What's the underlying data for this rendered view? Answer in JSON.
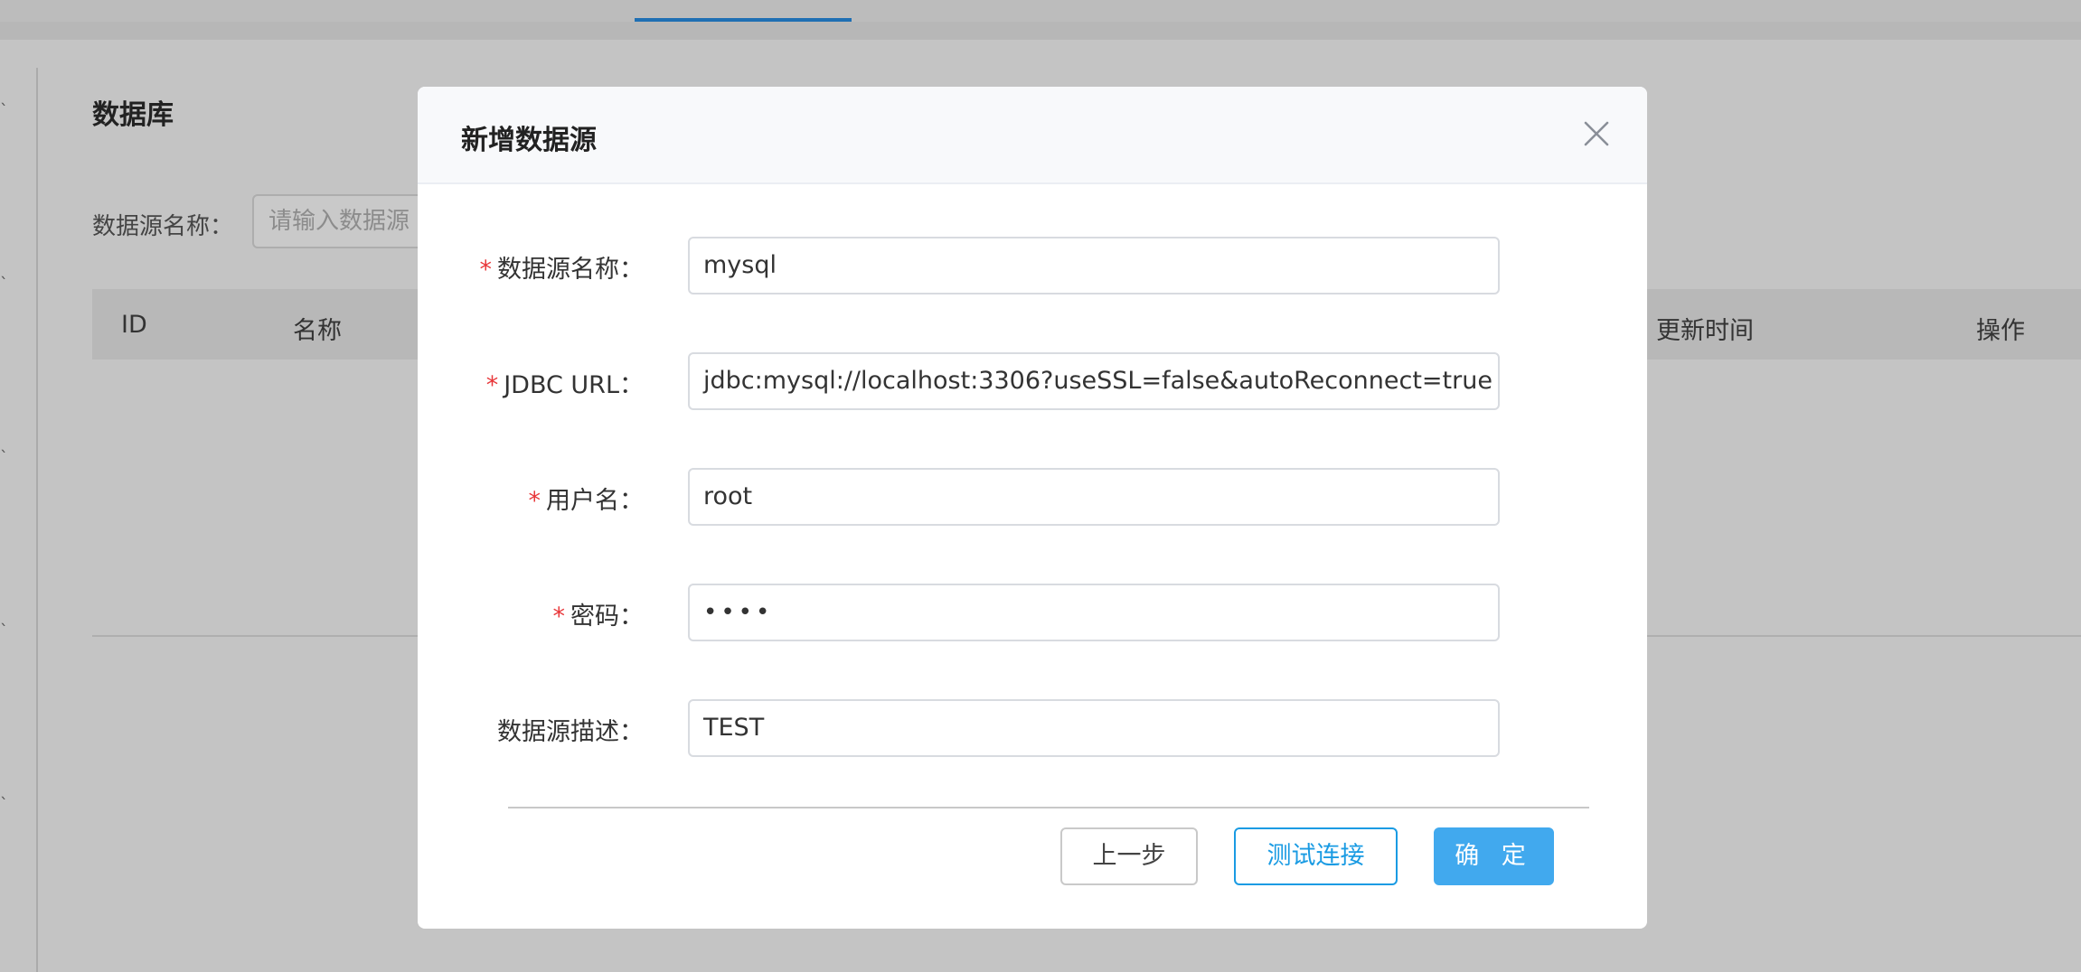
{
  "background": {
    "page_title": "数据库",
    "search": {
      "label": "数据源名称：",
      "placeholder": "请输入数据源"
    },
    "table": {
      "columns": [
        "ID",
        "名称",
        "更新时间",
        "操作"
      ]
    }
  },
  "modal": {
    "title": "新增数据源",
    "fields": {
      "name": {
        "label": "数据源名称：",
        "required": true,
        "value": "mysql"
      },
      "jdbc_url": {
        "label": "JDBC URL：",
        "required": true,
        "value": "jdbc:mysql://localhost:3306?useSSL=false&autoReconnect=true"
      },
      "username": {
        "label": "用户名：",
        "required": true,
        "value": "root"
      },
      "password": {
        "label": "密码：",
        "required": true,
        "value": "••••"
      },
      "description": {
        "label": "数据源描述：",
        "required": false,
        "value": "TEST"
      }
    },
    "required_mark": "*",
    "buttons": {
      "prev": "上一步",
      "test": "测试连接",
      "ok": "确 定"
    }
  },
  "colors": {
    "primary": "#41a9ee",
    "required": "#e8373a",
    "overlay": "#c4c4c4"
  }
}
